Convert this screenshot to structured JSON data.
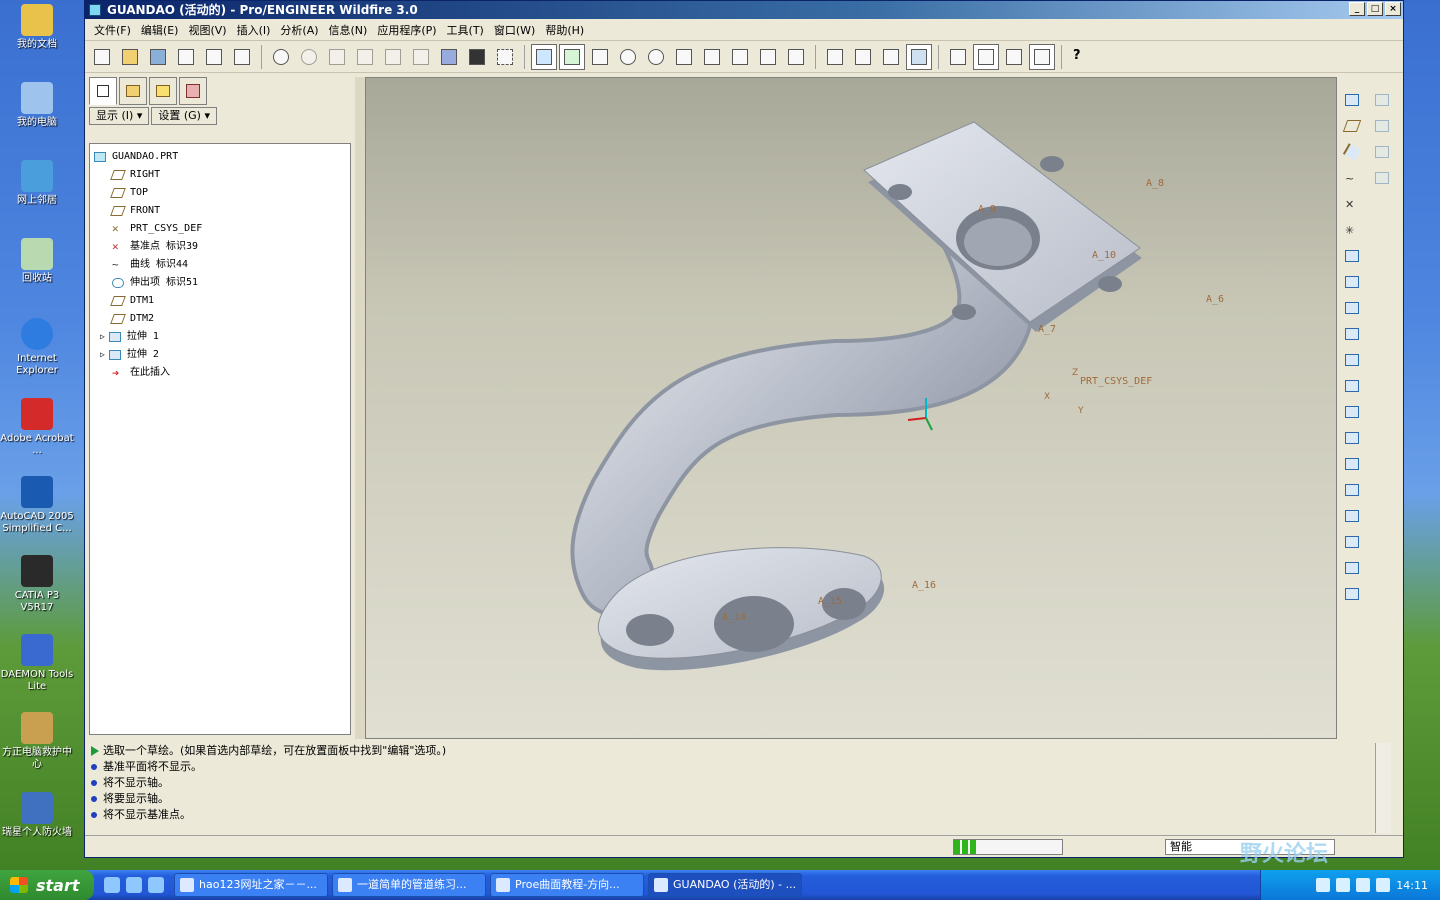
{
  "desktop": {
    "icons": [
      {
        "label": "我的文档",
        "color": "#e8c24a"
      },
      {
        "label": "我的电脑",
        "color": "#9ec4ee"
      },
      {
        "label": "网上邻居",
        "color": "#4a9edc"
      },
      {
        "label": "回收站",
        "color": "#b9d9b0"
      },
      {
        "label": "Internet Explorer",
        "color": "#2e7ce0"
      },
      {
        "label": "Adobe Acrobat ...",
        "color": "#d42a2a"
      },
      {
        "label": "AutoCAD 2005 Simplified C...",
        "color": "#1a5ab0"
      },
      {
        "label": "CATIA P3 V5R17",
        "color": "#2a2a2a"
      },
      {
        "label": "DAEMON Tools Lite",
        "color": "#3a6ad0"
      },
      {
        "label": "方正电脑救护中心",
        "color": "#c8a050"
      },
      {
        "label": "瑞星个人防火墙",
        "color": "#4070c0"
      }
    ]
  },
  "window": {
    "title": "GUANDAO (活动的) - Pro/ENGINEER Wildfire 3.0",
    "buttons": [
      "_",
      "□",
      "×"
    ]
  },
  "menu": [
    "文件(F)",
    "编辑(E)",
    "视图(V)",
    "插入(I)",
    "分析(A)",
    "信息(N)",
    "应用程序(P)",
    "工具(T)",
    "窗口(W)",
    "帮助(H)"
  ],
  "panel": {
    "show_label": "显示 (I) ▾",
    "settings_label": "设置 (G) ▾",
    "tree": [
      {
        "label": "GUANDAO.PRT",
        "indent": 0
      },
      {
        "label": "RIGHT",
        "indent": 1
      },
      {
        "label": "TOP",
        "indent": 1
      },
      {
        "label": "FRONT",
        "indent": 1
      },
      {
        "label": "PRT_CSYS_DEF",
        "indent": 1
      },
      {
        "label": "基准点 标识39",
        "indent": 1
      },
      {
        "label": "曲线 标识44",
        "indent": 1
      },
      {
        "label": "伸出项 标识51",
        "indent": 1
      },
      {
        "label": "DTM1",
        "indent": 1
      },
      {
        "label": "DTM2",
        "indent": 1
      },
      {
        "label": "拉伸 1",
        "indent": 1
      },
      {
        "label": "拉伸 2",
        "indent": 1
      },
      {
        "label": "在此插入",
        "indent": 1
      }
    ]
  },
  "model": {
    "axis_labels": [
      "A_9",
      "A_8",
      "A_10",
      "A_7",
      "A_6",
      "A_14",
      "A_15",
      "A_16"
    ],
    "csys_label": "PRT_CSYS_DEF",
    "csys_axes": {
      "z": "Z",
      "x": "X",
      "y": "Y"
    }
  },
  "messages": [
    {
      "type": "prompt",
      "text": "选取一个草绘。(如果首选内部草绘，可在放置面板中找到\"编辑\"选项。)"
    },
    {
      "type": "info",
      "text": "基准平面将不显示。"
    },
    {
      "type": "info",
      "text": "将不显示轴。"
    },
    {
      "type": "info",
      "text": "将要显示轴。"
    },
    {
      "type": "info",
      "text": "将不显示基准点。"
    }
  ],
  "status": {
    "filter": "智能",
    "progress": 0.2
  },
  "taskbar": {
    "start": "start",
    "tasks": [
      "hao123网址之家－－...",
      "一道简单的管道练习...",
      "Proe曲面教程-方向...",
      "GUANDAO (活动的) - ..."
    ],
    "clock": "14:11"
  },
  "watermark": "野火论坛"
}
